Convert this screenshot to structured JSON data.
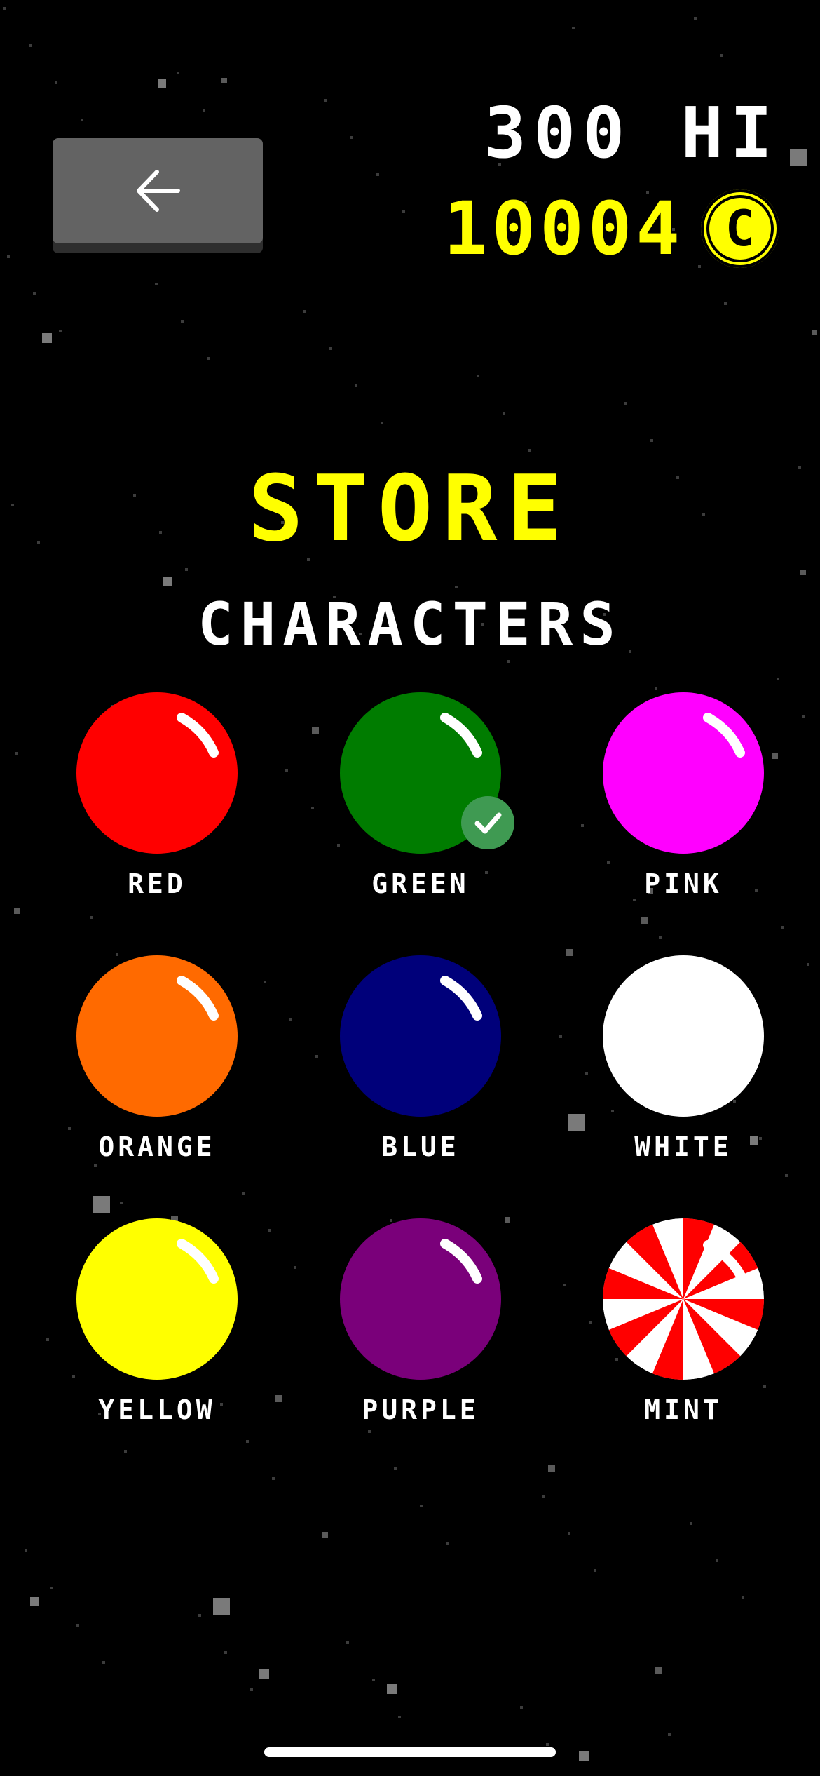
{
  "header": {
    "back_icon": "arrow-left-icon",
    "hi_score": "300 HI",
    "coins": "10004",
    "coin_symbol": "C",
    "coin_icon": "coin-icon"
  },
  "store": {
    "title": "STORE",
    "section": "CHARACTERS"
  },
  "characters": [
    {
      "label": "RED",
      "color": "#ff0000",
      "selected": false
    },
    {
      "label": "GREEN",
      "color": "#007c00",
      "selected": true
    },
    {
      "label": "PINK",
      "color": "#ff00ff",
      "selected": false
    },
    {
      "label": "ORANGE",
      "color": "#ff6a00",
      "selected": false
    },
    {
      "label": "BLUE",
      "color": "#00007a",
      "selected": false
    },
    {
      "label": "WHITE",
      "color": "#ffffff",
      "selected": false
    },
    {
      "label": "YELLOW",
      "color": "#ffff00",
      "selected": false
    },
    {
      "label": "PURPLE",
      "color": "#7a007a",
      "selected": false
    },
    {
      "label": "MINT",
      "color": "#ff0000",
      "selected": false,
      "pattern": "peppermint-swirl"
    }
  ],
  "selected_icon": "checkmark-icon",
  "colors": {
    "accent": "#ffff00",
    "background": "#000000",
    "button": "#636363",
    "badge": "#3f9a52"
  }
}
